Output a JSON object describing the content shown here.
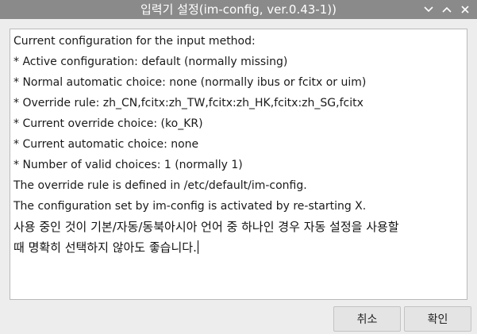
{
  "window": {
    "title": "입력기 설정(im-config, ver.0.43-1))",
    "controls": [
      "chevron-down-icon",
      "chevron-up-icon",
      "close-icon"
    ]
  },
  "content": {
    "lines": [
      "Current configuration for the input method:",
      " * Active configuration: default (normally missing)",
      " * Normal automatic choice: none (normally ibus or fcitx or uim)",
      " * Override rule: zh_CN,fcitx:zh_TW,fcitx:zh_HK,fcitx:zh_SG,fcitx",
      " * Current override choice:  (ko_KR)",
      " * Current automatic choice: none",
      " * Number of valid choices: 1 (normally 1)",
      "The override rule is defined in /etc/default/im-config.",
      "The configuration set by im-config is activated by re-starting X.",
      "사용 중인 것이 기본/자동/동북아시아 언어 중 하나인 경우 자동 설정을 사용할",
      "때 명확히 선택하지 않아도 좋습니다."
    ]
  },
  "buttons": {
    "cancel_label": "취소",
    "ok_label": "확인"
  },
  "colors": {
    "titlebar": "#8a8a8a",
    "background": "#ededed",
    "text": "#1a1a1a"
  }
}
